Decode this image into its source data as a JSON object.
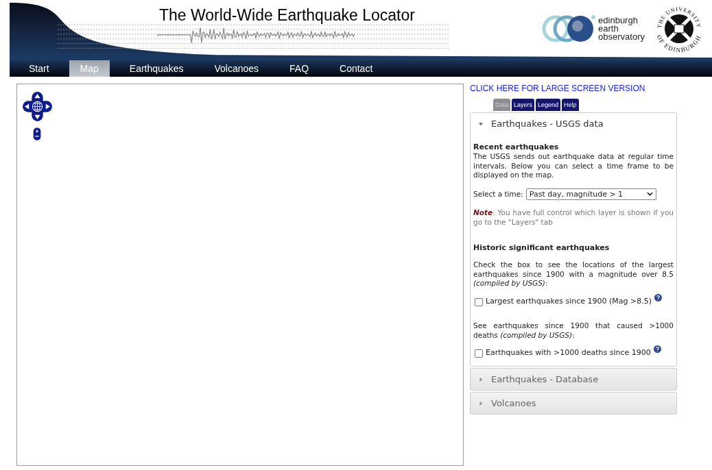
{
  "header": {
    "title": "The World-Wide Earthquake Locator",
    "logo_text": [
      "edinburgh",
      "earth",
      "observatory"
    ],
    "seal_text": {
      "top": "THE UNIVERSITY",
      "bottom": "OF EDINBURGH"
    }
  },
  "nav": [
    {
      "label": "Start",
      "selected": false
    },
    {
      "label": "Map",
      "selected": true
    },
    {
      "label": "Earthquakes",
      "selected": false
    },
    {
      "label": "Volcanoes",
      "selected": false
    },
    {
      "label": "FAQ",
      "selected": false
    },
    {
      "label": "Contact",
      "selected": false
    }
  ],
  "sidebar": {
    "large_screen_link": "CLICK HERE FOR LARGE SCREEN VERSION",
    "tabs": [
      {
        "label": "Data",
        "selected": true
      },
      {
        "label": "Layers",
        "selected": false
      },
      {
        "label": "Legend",
        "selected": false
      },
      {
        "label": "Help",
        "selected": false
      }
    ],
    "sections": [
      {
        "title": "Earthquakes - USGS data",
        "expanded": true,
        "content": [
          {
            "kind": "heading",
            "text": "Recent earthquakes"
          },
          {
            "kind": "paragraph",
            "text": "The USGS sends out earthquake data at regular time intervals. Below you can select a time frame to be displayed on the map."
          },
          {
            "kind": "select",
            "label": "Select a time:",
            "value": "Past day, magnitude > 1"
          },
          {
            "kind": "note",
            "text": "**Note**: You have full control which layer is shown if you go to the \"Layers\" tab"
          },
          {
            "kind": "heading",
            "text": "Historic significant earthquakes"
          },
          {
            "kind": "paragraph",
            "text": "Check the box to see the locations of the largest earthquakes since 1900 with a magnitude over 8.5 *(compiled by USGS)*:"
          },
          {
            "kind": "checkbox",
            "label": "Largest earthquakes since 1900 (Mag >8.5)",
            "checked": false
          },
          {
            "kind": "paragraph",
            "text": "See earthquakes since 1900 that caused >1000 deaths *(compiled by USGS)*:"
          },
          {
            "kind": "checkbox",
            "label": "Earthquakes with >1000 deaths since 1900",
            "checked": false
          }
        ]
      },
      {
        "title": "Earthquakes - Database",
        "expanded": false
      },
      {
        "title": "Volcanoes",
        "expanded": false
      }
    ]
  }
}
